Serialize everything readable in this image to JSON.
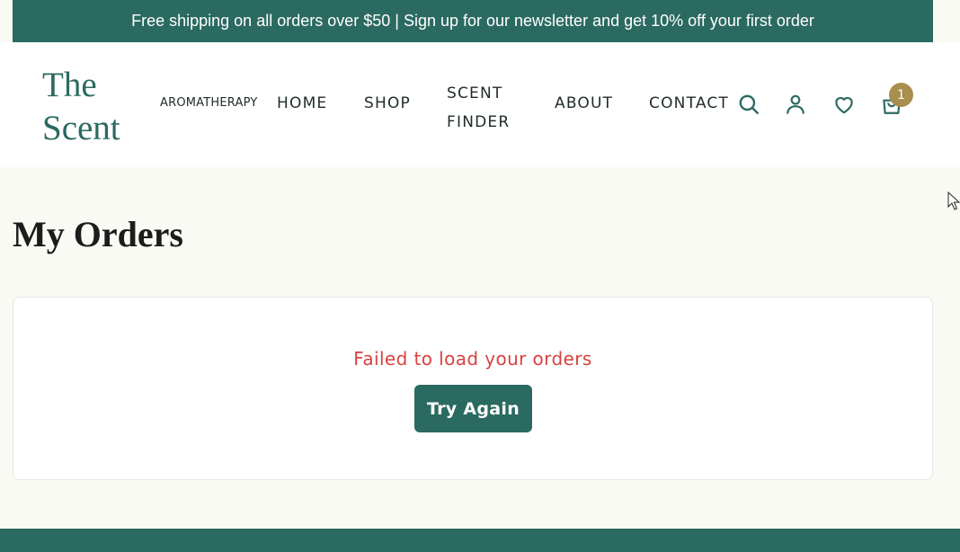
{
  "announcement": "Free shipping on all orders over $50 | Sign up for our newsletter and get 10% off your first order",
  "brand": {
    "logo_line1": "The",
    "logo_line2": "Scent",
    "tagline": "AROMATHERAPY"
  },
  "nav": {
    "home": "HOME",
    "shop": "SHOP",
    "finder_line1": "SCENT",
    "finder_line2": "FINDER",
    "about": "ABOUT",
    "contact": "CONTACT"
  },
  "icons": {
    "search": "search-icon",
    "account": "user-icon",
    "wishlist": "heart-icon",
    "cart": "shopping-bag-icon"
  },
  "cart": {
    "count": "1"
  },
  "page": {
    "title": "My Orders"
  },
  "orders": {
    "error_message": "Failed to load your orders",
    "retry_label": "Try Again"
  },
  "colors": {
    "primary": "#2b6a60",
    "accent": "#a98e4f",
    "error": "#d8423f",
    "background": "#fafaf5"
  }
}
